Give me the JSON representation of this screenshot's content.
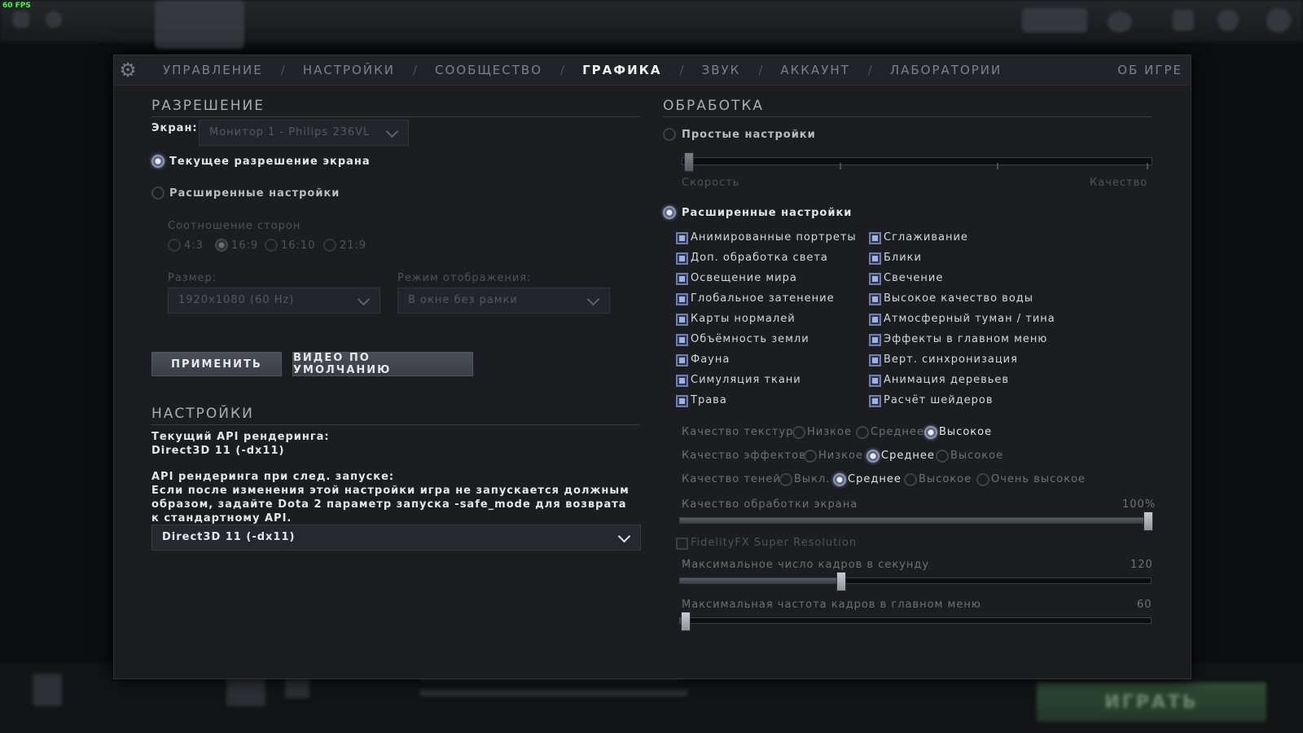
{
  "fps": "60 FPS",
  "tabs": {
    "items": [
      "УПРАВЛЕНИЕ",
      "НАСТРОЙКИ",
      "СООБЩЕСТВО",
      "ГРАФИКА",
      "ЗВУК",
      "АККАУНТ",
      "ЛАБОРАТОРИИ"
    ],
    "active": "ГРАФИКА",
    "about": "ОБ ИГРЕ",
    "separator": "/"
  },
  "resolution": {
    "title": "РАЗРЕШЕНИЕ",
    "screen_label": "Экран:",
    "screen_value": "Монитор 1 - Philips 236VL",
    "current_option": "Текущее разрешение экрана",
    "advanced_option": "Расширенные настройки",
    "aspect_label": "Соотношение сторон",
    "aspect_options": [
      "4:3",
      "16:9",
      "16:10",
      "21:9"
    ],
    "aspect_selected": "16:9",
    "size_label": "Размер:",
    "size_value": "1920x1080 (60 Hz)",
    "mode_label": "Режим отображения:",
    "mode_value": "В окне без рамки",
    "apply_button": "ПРИМЕНИТЬ",
    "default_button": "ВИДЕО ПО УМОЛЧАНИЮ"
  },
  "settings": {
    "title": "НАСТРОЙКИ",
    "current_api_label": "Текущий API рендеринга:",
    "current_api_value": "Direct3D 11 (-dx11)",
    "next_api_label": "API рендеринга при след. запуске:",
    "next_api_note": "Если после изменения этой настройки игра не запускается должным образом, задайте Dota 2 параметр запуска -safe_mode для возврата к стандартному API.",
    "api_dropdown_value": "Direct3D 11 (-dx11)"
  },
  "processing": {
    "title": "ОБРАБОТКА",
    "simple_option": "Простые настройки",
    "simple_slider_left": "Скорость",
    "simple_slider_right": "Качество",
    "advanced_option": "Расширенные настройки",
    "checkboxes_left": [
      "Анимированные портреты",
      "Доп. обработка света",
      "Освещение мира",
      "Глобальное затенение",
      "Карты нормалей",
      "Объёмность земли",
      "Фауна",
      "Симуляция ткани",
      "Трава"
    ],
    "checkboxes_right": [
      "Сглаживание",
      "Блики",
      "Свечение",
      "Высокое качество воды",
      "Атмосферный туман / тина",
      "Эффекты в главном меню",
      "Верт. синхронизация",
      "Анимация деревьев",
      "Расчёт шейдеров"
    ],
    "texture_quality": {
      "label": "Качество текстур",
      "options": [
        "Низкое",
        "Среднее",
        "Высокое"
      ],
      "selected": "Высокое"
    },
    "effects_quality": {
      "label": "Качество эффектов",
      "options": [
        "Низкое",
        "Среднее",
        "Высокое"
      ],
      "selected": "Среднее"
    },
    "shadow_quality": {
      "label": "Качество теней",
      "options": [
        "Выкл.",
        "Среднее",
        "Высокое",
        "Очень высокое"
      ],
      "selected": "Среднее"
    },
    "screen_quality": {
      "label": "Качество обработки экрана",
      "value": "100%",
      "fraction": 1.0
    },
    "fsr_label": "FidelityFX Super Resolution",
    "max_fps": {
      "label": "Максимальное число кадров в секунду",
      "value": "120",
      "fraction": 0.34
    },
    "max_menu_fps": {
      "label": "Максимальная частота кадров в главном меню",
      "value": "60",
      "fraction": 0.0
    }
  },
  "play_button": "ИГРАТЬ"
}
